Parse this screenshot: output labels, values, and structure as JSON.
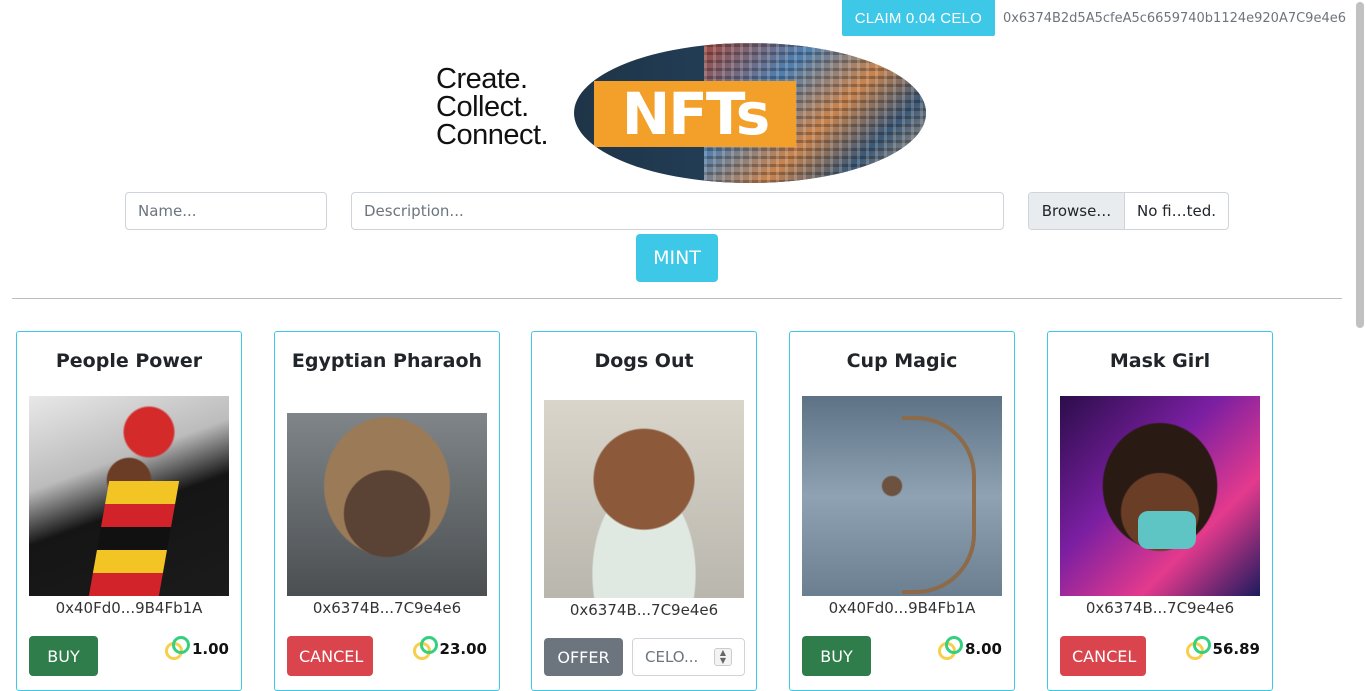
{
  "header": {
    "claim_label": "CLAIM 0.04 CELO",
    "wallet_address": "0x6374B2d5A5cfeA5c6659740b1124e920A7C9e4e6"
  },
  "banner": {
    "tagline": [
      "Create.",
      "Collect.",
      "Connect."
    ],
    "logo_text": "NFTs"
  },
  "mint_form": {
    "name_placeholder": "Name...",
    "description_placeholder": "Description...",
    "browse_label": "Browse…",
    "file_status": "No fi…ted.",
    "mint_label": "MINT"
  },
  "colors": {
    "accent": "#3cc8e6",
    "buy": "#2e7d4a",
    "cancel": "#d9444d",
    "offer": "#6c757d"
  },
  "nfts": [
    {
      "title": "People Power",
      "owner": "0x40Fd0...9B4Fb1A",
      "action": "BUY",
      "price": "1.00"
    },
    {
      "title": "Egyptian Pharaoh",
      "owner": "0x6374B...7C9e4e6",
      "action": "CANCEL",
      "price": "23.00"
    },
    {
      "title": "Dogs Out",
      "owner": "0x6374B...7C9e4e6",
      "action": "OFFER",
      "offer_placeholder": "CELO..."
    },
    {
      "title": "Cup Magic",
      "owner": "0x40Fd0...9B4Fb1A",
      "action": "BUY",
      "price": "8.00"
    },
    {
      "title": "Mask Girl",
      "owner": "0x6374B...7C9e4e6",
      "action": "CANCEL",
      "price": "56.89"
    }
  ]
}
